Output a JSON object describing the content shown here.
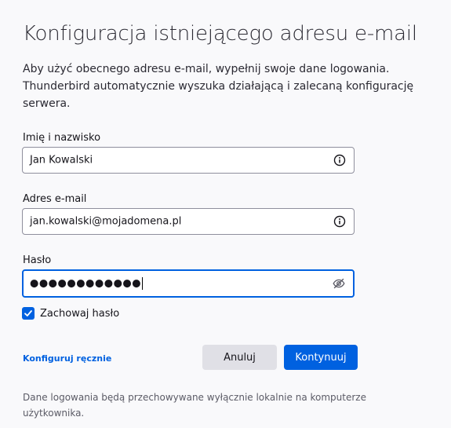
{
  "dialog": {
    "title": "Konfiguracja istniejącego adresu e-mail",
    "description_line1": "Aby użyć obecnego adresu e-mail, wypełnij swoje dane logowania.",
    "description_line2": "Thunderbird automatycznie wyszuka działającą i zalecaną konfigurację serwera."
  },
  "form": {
    "name": {
      "label": "Imię i nazwisko",
      "value": "Jan Kowalski",
      "icon": "info-icon"
    },
    "email": {
      "label": "Adres e-mail",
      "value": "jan.kowalski@mojadomena.pl",
      "icon": "info-icon"
    },
    "password": {
      "label": "Hasło",
      "masked_value": "●●●●●●●●●●●●",
      "icon": "eye-slash-icon"
    },
    "remember_password": {
      "label": "Zachowaj hasło",
      "checked": true
    }
  },
  "actions": {
    "manual_config_label": "Konfiguruj ręcznie",
    "cancel_label": "Anuluj",
    "continue_label": "Kontynuuj"
  },
  "footer": {
    "note": "Dane logowania będą przechowywane wyłącznie lokalnie na komputerze użytkownika."
  },
  "colors": {
    "accent": "#0061e0",
    "background": "#f9f9fb",
    "secondary_button": "#e0e0e6"
  }
}
